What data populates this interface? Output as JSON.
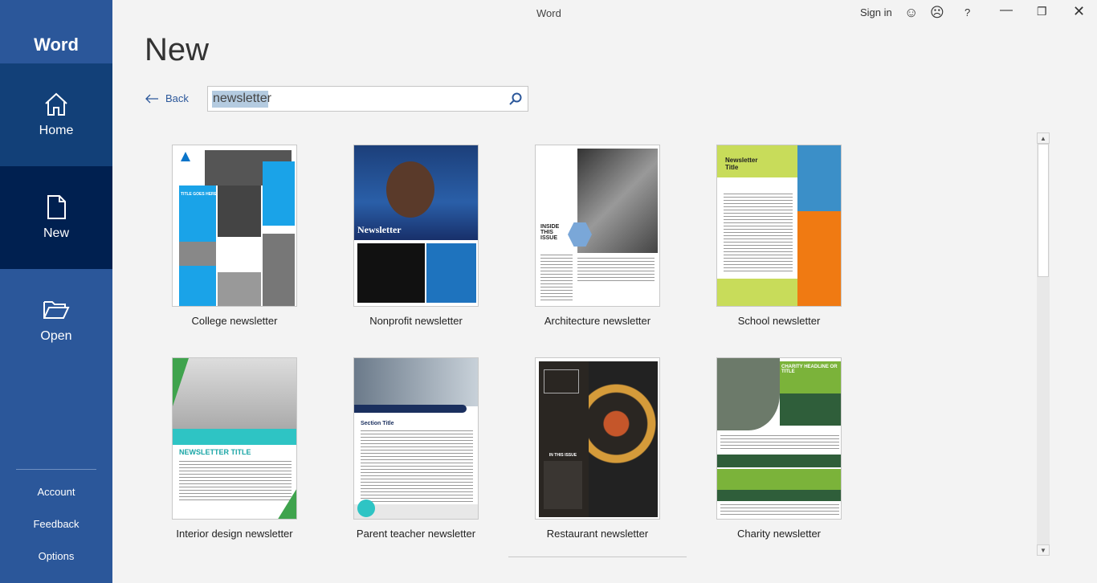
{
  "app": {
    "name": "Word",
    "window_title": "Word"
  },
  "titlebar": {
    "sign_in": "Sign in",
    "help": "?"
  },
  "sidebar": {
    "items": [
      {
        "label": "Home",
        "icon": "home-icon"
      },
      {
        "label": "New",
        "icon": "new-document-icon"
      },
      {
        "label": "Open",
        "icon": "folder-open-icon"
      }
    ],
    "bottom": [
      {
        "label": "Account"
      },
      {
        "label": "Feedback"
      },
      {
        "label": "Options"
      }
    ]
  },
  "page": {
    "title": "New",
    "back_label": "Back",
    "search_value": "newsletter"
  },
  "colors": {
    "sidebar": "#2b579a",
    "sidebar_hover": "#124078",
    "sidebar_selected": "#002050",
    "accent": "#2b579a"
  },
  "templates": [
    {
      "label": "College newsletter"
    },
    {
      "label": "Nonprofit newsletter"
    },
    {
      "label": "Architecture newsletter"
    },
    {
      "label": "School newsletter"
    },
    {
      "label": "Interior design newsletter"
    },
    {
      "label": "Parent teacher newsletter"
    },
    {
      "label": "Restaurant newsletter"
    },
    {
      "label": "Charity newsletter"
    }
  ],
  "thumb_text": {
    "nonprofit": "Newsletter",
    "architecture": "INSIDE THIS ISSUE",
    "school": "Newsletter Title",
    "interior": "NEWSLETTER TITLE",
    "parent": "Section Title",
    "restaurant": "IN THIS ISSUE",
    "charity": "CHARITY HEADLINE OR TITLE",
    "college": "TITLE GOES HERE"
  }
}
